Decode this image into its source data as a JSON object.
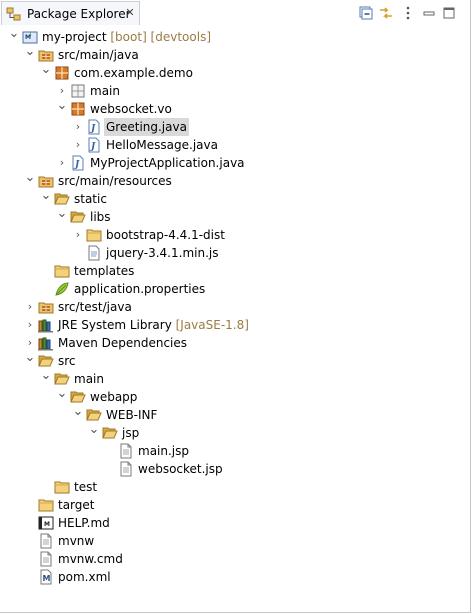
{
  "view": {
    "title": "Package Explorer",
    "close_glyph": "✕",
    "toolbar": [
      {
        "name": "collapse-all-icon"
      },
      {
        "name": "link-with-editor-icon"
      },
      {
        "name": "view-menu-icon"
      },
      {
        "name": "minimize-icon"
      },
      {
        "name": "maximize-icon"
      }
    ]
  },
  "tree": [
    {
      "depth": 0,
      "expanded": true,
      "icon": "project-icon",
      "label": "my-project",
      "decor": " [boot] [devtools]"
    },
    {
      "depth": 1,
      "expanded": true,
      "icon": "source-folder-icon",
      "label": "src/main/java"
    },
    {
      "depth": 2,
      "expanded": true,
      "icon": "package-icon",
      "label": "com.example.demo"
    },
    {
      "depth": 3,
      "expanded": false,
      "icon": "empty-package-icon",
      "label": "main"
    },
    {
      "depth": 3,
      "expanded": true,
      "icon": "package-icon",
      "label": "websocket.vo"
    },
    {
      "depth": 4,
      "expanded": false,
      "icon": "java-file-icon",
      "label": "Greeting.java",
      "selected": true
    },
    {
      "depth": 4,
      "expanded": false,
      "icon": "java-file-icon",
      "label": "HelloMessage.java"
    },
    {
      "depth": 3,
      "expanded": false,
      "icon": "java-file-icon",
      "label": "MyProjectApplication.java"
    },
    {
      "depth": 1,
      "expanded": true,
      "icon": "source-folder-icon",
      "label": "src/main/resources"
    },
    {
      "depth": 2,
      "expanded": true,
      "icon": "folder-open-icon",
      "label": "static"
    },
    {
      "depth": 3,
      "expanded": true,
      "icon": "folder-open-icon",
      "label": "libs"
    },
    {
      "depth": 4,
      "expanded": false,
      "icon": "folder-icon",
      "label": "bootstrap-4.4.1-dist"
    },
    {
      "depth": 4,
      "leaf": true,
      "icon": "js-file-icon",
      "label": "jquery-3.4.1.min.js"
    },
    {
      "depth": 2,
      "leaf": true,
      "icon": "folder-icon",
      "label": "templates"
    },
    {
      "depth": 2,
      "leaf": true,
      "icon": "properties-file-icon",
      "label": "application.properties"
    },
    {
      "depth": 1,
      "expanded": false,
      "icon": "source-folder-icon",
      "label": "src/test/java"
    },
    {
      "depth": 1,
      "expanded": false,
      "icon": "library-icon",
      "label": "JRE System Library",
      "decor": " [JavaSE-1.8]"
    },
    {
      "depth": 1,
      "expanded": false,
      "icon": "maven-library-icon",
      "label": "Maven Dependencies"
    },
    {
      "depth": 1,
      "expanded": true,
      "icon": "folder-open-icon",
      "label": "src"
    },
    {
      "depth": 2,
      "expanded": true,
      "icon": "folder-open-icon",
      "label": "main"
    },
    {
      "depth": 3,
      "expanded": true,
      "icon": "folder-open-icon",
      "label": "webapp"
    },
    {
      "depth": 4,
      "expanded": true,
      "icon": "folder-open-icon",
      "label": "WEB-INF"
    },
    {
      "depth": 5,
      "expanded": true,
      "icon": "folder-open-icon",
      "label": "jsp"
    },
    {
      "depth": 6,
      "leaf": true,
      "icon": "text-file-icon",
      "label": "main.jsp"
    },
    {
      "depth": 6,
      "leaf": true,
      "icon": "text-file-icon",
      "label": "websocket.jsp"
    },
    {
      "depth": 2,
      "leaf": true,
      "icon": "folder-icon",
      "label": "test"
    },
    {
      "depth": 1,
      "leaf": true,
      "icon": "folder-icon",
      "label": "target"
    },
    {
      "depth": 1,
      "leaf": true,
      "icon": "markdown-file-icon",
      "label": "HELP.md"
    },
    {
      "depth": 1,
      "leaf": true,
      "icon": "text-file-icon",
      "label": "mvnw"
    },
    {
      "depth": 1,
      "leaf": true,
      "icon": "text-file-icon",
      "label": "mvnw.cmd"
    },
    {
      "depth": 1,
      "leaf": true,
      "icon": "maven-pom-icon",
      "label": "pom.xml"
    }
  ]
}
